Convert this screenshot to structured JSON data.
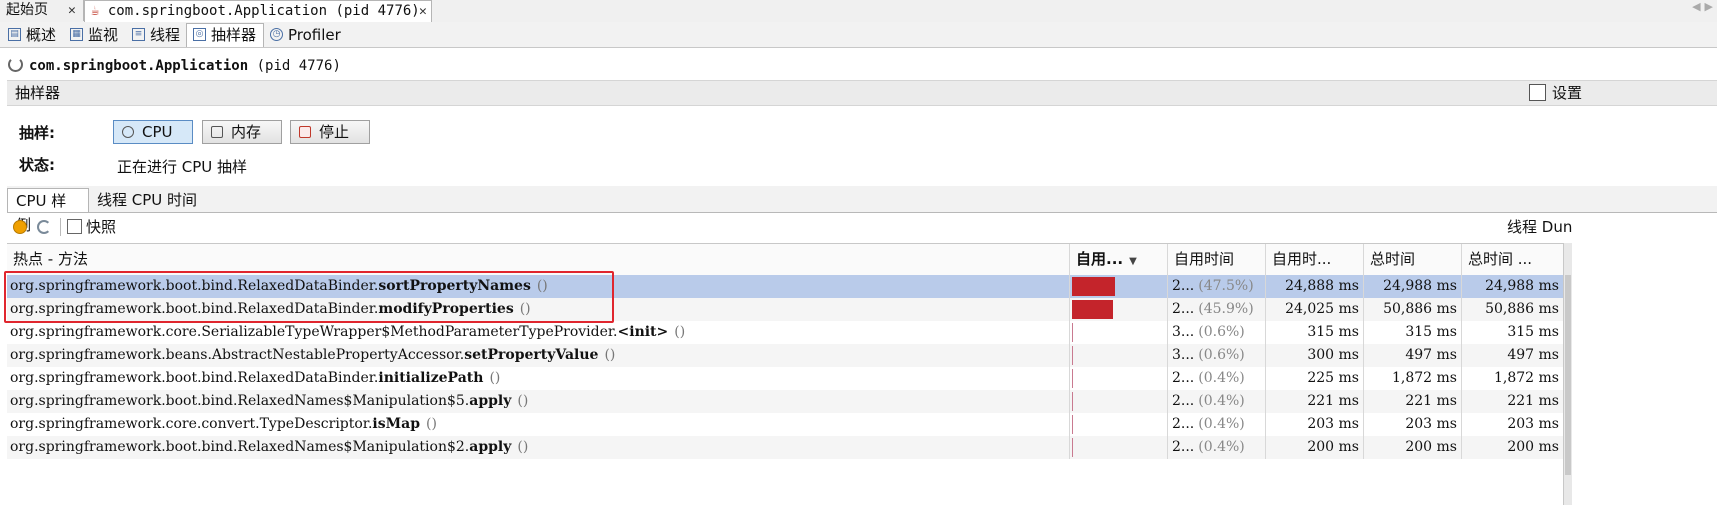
{
  "doc_tabs": [
    {
      "label": "起始页"
    },
    {
      "label": "com.springboot.Application (pid 4776)"
    }
  ],
  "view_tabs": [
    {
      "label": "概述",
      "icon": "overview-icon"
    },
    {
      "label": "监视",
      "icon": "monitor-icon"
    },
    {
      "label": "线程",
      "icon": "threads-icon"
    },
    {
      "label": "抽样器",
      "icon": "sampler-icon"
    },
    {
      "label": "Profiler",
      "icon": "profiler-icon"
    }
  ],
  "app": {
    "name": "com.springboot.Application",
    "pid": "(pid 4776)"
  },
  "section": {
    "title": "抽样器",
    "settings_label": "设置"
  },
  "sampling": {
    "label": "抽样:",
    "buttons": {
      "cpu": "CPU",
      "memory": "内存",
      "stop": "停止"
    },
    "status_label": "状态:",
    "status_value": "正在进行 CPU 抽样"
  },
  "sub_tabs": [
    "CPU 样例",
    "线程 CPU 时间"
  ],
  "toolbar": {
    "snapshot": "快照",
    "thread_dump": "线程 Dun"
  },
  "table": {
    "columns": [
      "热点 - 方法",
      "自用...",
      "自用时间",
      "自用时...",
      "总时间",
      "总时间 ..."
    ],
    "rows": [
      {
        "prefix": "org.springframework.boot.bind.RelaxedDataBinder.",
        "method": "sortPropertyNames",
        "params": "()",
        "bar_fraction": 0.475,
        "self_time": "2...",
        "self_pct": "(47.5%)",
        "self_ms": "24,888 ms",
        "total": "24,988 ms",
        "total2": "24,988 ms"
      },
      {
        "prefix": "org.springframework.boot.bind.RelaxedDataBinder.",
        "method": "modifyProperties",
        "params": "()",
        "bar_fraction": 0.459,
        "self_time": "2...",
        "self_pct": "(45.9%)",
        "self_ms": "24,025 ms",
        "total": "50,886 ms",
        "total2": "50,886 ms"
      },
      {
        "prefix": "org.springframework.core.SerializableTypeWrapper$MethodParameterTypeProvider.",
        "method": "<init>",
        "params": "()",
        "bar_fraction": 0.006,
        "self_time": "3...",
        "self_pct": "(0.6%)",
        "self_ms": "315 ms",
        "total": "315 ms",
        "total2": "315 ms"
      },
      {
        "prefix": "org.springframework.beans.AbstractNestablePropertyAccessor.",
        "method": "setPropertyValue",
        "params": "()",
        "bar_fraction": 0.006,
        "self_time": "3...",
        "self_pct": "(0.6%)",
        "self_ms": "300 ms",
        "total": "497 ms",
        "total2": "497 ms"
      },
      {
        "prefix": "org.springframework.boot.bind.RelaxedDataBinder.",
        "method": "initializePath",
        "params": "()",
        "bar_fraction": 0.004,
        "self_time": "2...",
        "self_pct": "(0.4%)",
        "self_ms": "225 ms",
        "total": "1,872 ms",
        "total2": "1,872 ms"
      },
      {
        "prefix": "org.springframework.boot.bind.RelaxedNames$Manipulation$5.",
        "method": "apply",
        "params": "()",
        "bar_fraction": 0.004,
        "self_time": "2...",
        "self_pct": "(0.4%)",
        "self_ms": "221 ms",
        "total": "221 ms",
        "total2": "221 ms"
      },
      {
        "prefix": "org.springframework.core.convert.TypeDescriptor.",
        "method": "isMap",
        "params": "()",
        "bar_fraction": 0.004,
        "self_time": "2...",
        "self_pct": "(0.4%)",
        "self_ms": "203 ms",
        "total": "203 ms",
        "total2": "203 ms"
      },
      {
        "prefix": "org.springframework.boot.bind.RelaxedNames$Manipulation$2.",
        "method": "apply",
        "params": "()",
        "bar_fraction": 0.004,
        "self_time": "2...",
        "self_pct": "(0.4%)",
        "self_ms": "200 ms",
        "total": "200 ms",
        "total2": "200 ms"
      }
    ]
  },
  "colors": {
    "bar": "#c4242b",
    "selected_row": "#b9cbea",
    "highlight_box": "#e0262e"
  }
}
